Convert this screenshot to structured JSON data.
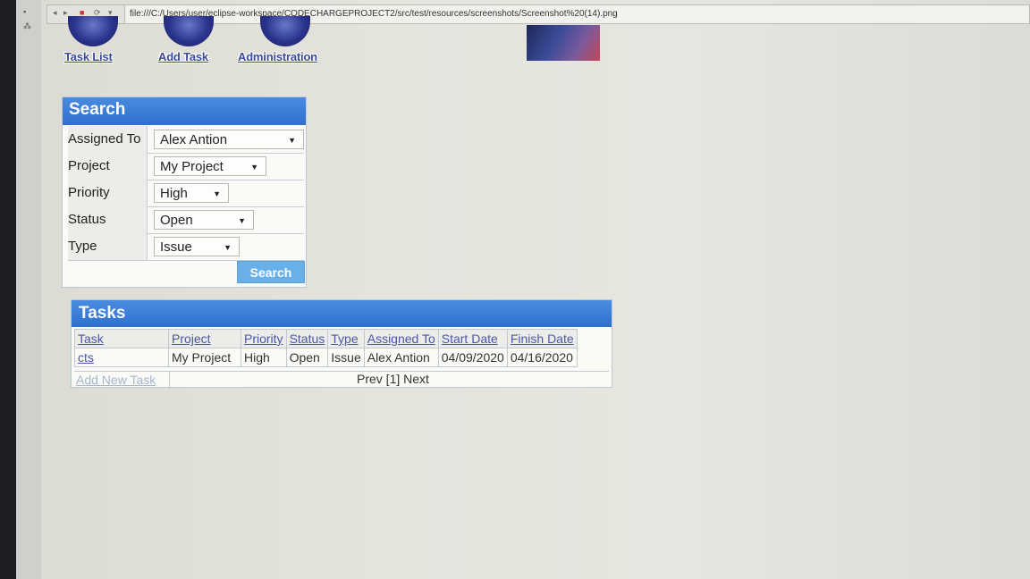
{
  "browser": {
    "url": "file:///C:/Users/user/eclipse-workspace/CODECHARGEPROJECT2/src/test/resources/screenshots/Screenshot%20(14).png"
  },
  "nav": {
    "task_list": "Task List",
    "add_task": "Add Task",
    "administration": "Administration"
  },
  "search": {
    "title": "Search",
    "assigned_to_label": "Assigned To",
    "assigned_to_value": "Alex Antion",
    "project_label": "Project",
    "project_value": "My Project",
    "priority_label": "Priority",
    "priority_value": "High",
    "status_label": "Status",
    "status_value": "Open",
    "type_label": "Type",
    "type_value": "Issue",
    "button": "Search"
  },
  "tasks": {
    "title": "Tasks",
    "columns": [
      "Task",
      "Project",
      "Priority",
      "Status",
      "Type",
      "Assigned To",
      "Start Date",
      "Finish Date"
    ],
    "rows": [
      {
        "task": "cts",
        "project": "My Project",
        "priority": "High",
        "status": "Open",
        "type": "Issue",
        "assigned_to": "Alex Antion",
        "start_date": "04/09/2020",
        "finish_date": "04/16/2020"
      }
    ],
    "add_new": "Add New Task",
    "pager": "Prev [1] Next"
  },
  "colors": {
    "header_blue": "#3f7fda",
    "link": "#4a57a8",
    "button": "#6ab0e8"
  }
}
